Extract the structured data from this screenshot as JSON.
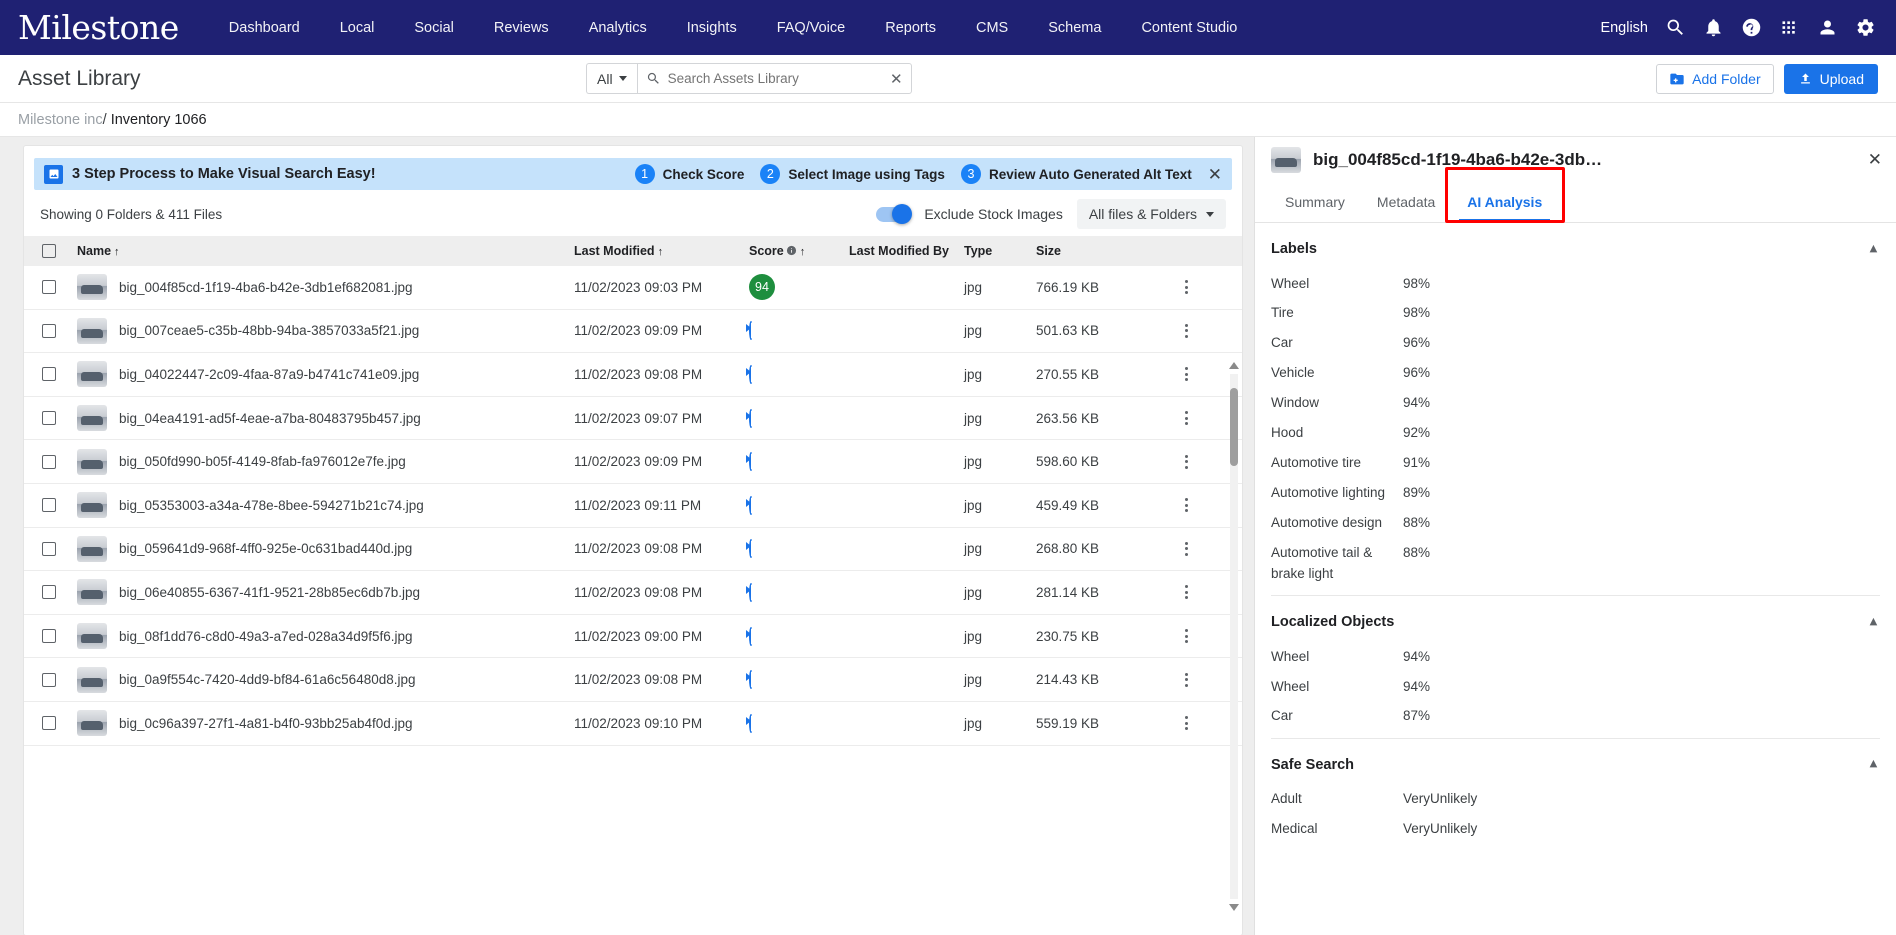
{
  "topnav": {
    "brand": "Milestone",
    "links": [
      "Dashboard",
      "Local",
      "Social",
      "Reviews",
      "Analytics",
      "Insights",
      "FAQ/Voice",
      "Reports",
      "CMS",
      "Schema",
      "Content Studio"
    ],
    "language": "English",
    "icons": [
      "search-icon",
      "bell-icon",
      "help-icon",
      "apps-grid-icon",
      "account-icon",
      "settings-gear-icon"
    ],
    "bg_color": "#1f2173"
  },
  "page_header": {
    "title": "Asset Library",
    "scope_filter": "All",
    "search_placeholder": "Search Assets Library",
    "search_value": "",
    "add_folder_label": "Add Folder",
    "upload_label": "Upload",
    "accent_color": "#1a73e8"
  },
  "breadcrumb": {
    "root": "Milestone inc",
    "separator": "/",
    "current": "Inventory 1066"
  },
  "banner": {
    "title": "3 Step Process to Make Visual Search Easy!",
    "steps": [
      {
        "num": "1",
        "label": "Check Score"
      },
      {
        "num": "2",
        "label": "Select Image using Tags"
      },
      {
        "num": "3",
        "label": "Review Auto Generated Alt Text"
      }
    ],
    "close": "✕",
    "bg_color": "#c5e2fb"
  },
  "toolbar": {
    "showing": "Showing 0 Folders & 411 Files",
    "exclude_stock_label": "Exclude Stock Images",
    "exclude_stock_on": true,
    "file_filter": "All files & Folders"
  },
  "table": {
    "columns": [
      {
        "key": "name",
        "label": "Name",
        "sorted": true,
        "arrow": "↑"
      },
      {
        "key": "modified",
        "label": "Last Modified",
        "sorted": true,
        "arrow": "↑"
      },
      {
        "key": "score",
        "label": "Score",
        "sorted": true,
        "arrow": "↑",
        "info": true
      },
      {
        "key": "modified_by",
        "label": "Last Modified By"
      },
      {
        "key": "type",
        "label": "Type"
      },
      {
        "key": "size",
        "label": "Size"
      }
    ],
    "rows": [
      {
        "name": "big_004f85cd-1f19-4ba6-b42e-3db1ef682081.jpg",
        "modified": "11/02/2023 09:03 PM",
        "score": "94",
        "score_state": "done",
        "modified_by": "",
        "type": "jpg",
        "size": "766.19 KB"
      },
      {
        "name": "big_007ceae5-c35b-48bb-94ba-3857033a5f21.jpg",
        "modified": "11/02/2023 09:09 PM",
        "score": "",
        "score_state": "loading",
        "modified_by": "",
        "type": "jpg",
        "size": "501.63 KB"
      },
      {
        "name": "big_04022447-2c09-4faa-87a9-b4741c741e09.jpg",
        "modified": "11/02/2023 09:08 PM",
        "score": "",
        "score_state": "loading",
        "modified_by": "",
        "type": "jpg",
        "size": "270.55 KB"
      },
      {
        "name": "big_04ea4191-ad5f-4eae-a7ba-80483795b457.jpg",
        "modified": "11/02/2023 09:07 PM",
        "score": "",
        "score_state": "loading",
        "modified_by": "",
        "type": "jpg",
        "size": "263.56 KB"
      },
      {
        "name": "big_050fd990-b05f-4149-8fab-fa976012e7fe.jpg",
        "modified": "11/02/2023 09:09 PM",
        "score": "",
        "score_state": "loading",
        "modified_by": "",
        "type": "jpg",
        "size": "598.60 KB"
      },
      {
        "name": "big_05353003-a34a-478e-8bee-594271b21c74.jpg",
        "modified": "11/02/2023 09:11 PM",
        "score": "",
        "score_state": "loading",
        "modified_by": "",
        "type": "jpg",
        "size": "459.49 KB"
      },
      {
        "name": "big_059641d9-968f-4ff0-925e-0c631bad440d.jpg",
        "modified": "11/02/2023 09:08 PM",
        "score": "",
        "score_state": "loading",
        "modified_by": "",
        "type": "jpg",
        "size": "268.80 KB"
      },
      {
        "name": "big_06e40855-6367-41f1-9521-28b85ec6db7b.jpg",
        "modified": "11/02/2023 09:08 PM",
        "score": "",
        "score_state": "loading",
        "modified_by": "",
        "type": "jpg",
        "size": "281.14 KB"
      },
      {
        "name": "big_08f1dd76-c8d0-49a3-a7ed-028a34d9f5f6.jpg",
        "modified": "11/02/2023 09:00 PM",
        "score": "",
        "score_state": "loading",
        "modified_by": "",
        "type": "jpg",
        "size": "230.75 KB"
      },
      {
        "name": "big_0a9f554c-7420-4dd9-bf84-61a6c56480d8.jpg",
        "modified": "11/02/2023 09:08 PM",
        "score": "",
        "score_state": "loading",
        "modified_by": "",
        "type": "jpg",
        "size": "214.43 KB"
      },
      {
        "name": "big_0c96a397-27f1-4a81-b4f0-93bb25ab4f0d.jpg",
        "modified": "11/02/2023 09:10 PM",
        "score": "",
        "score_state": "loading",
        "modified_by": "",
        "type": "jpg",
        "size": "559.19 KB"
      }
    ]
  },
  "right_panel": {
    "asset_title": "big_004f85cd-1f19-4ba6-b42e-3db…",
    "close": "✕",
    "tabs": [
      {
        "label": "Summary",
        "active": false
      },
      {
        "label": "Metadata",
        "active": false
      },
      {
        "label": "AI Analysis",
        "active": true
      }
    ],
    "highlight_color": "#ff0000",
    "sections": [
      {
        "title": "Labels",
        "collapse_icon": "chevron-up-icon",
        "items": [
          {
            "key": "Wheel",
            "value": "98%"
          },
          {
            "key": "Tire",
            "value": "98%"
          },
          {
            "key": "Car",
            "value": "96%"
          },
          {
            "key": "Vehicle",
            "value": "96%"
          },
          {
            "key": "Window",
            "value": "94%"
          },
          {
            "key": "Hood",
            "value": "92%"
          },
          {
            "key": "Automotive tire",
            "value": "91%"
          },
          {
            "key": "Automotive lighting",
            "value": "89%"
          },
          {
            "key": "Automotive design",
            "value": "88%"
          },
          {
            "key": "Automotive tail & brake light",
            "value": "88%"
          }
        ]
      },
      {
        "title": "Localized Objects",
        "collapse_icon": "chevron-up-icon",
        "items": [
          {
            "key": "Wheel",
            "value": "94%"
          },
          {
            "key": "Wheel",
            "value": "94%"
          },
          {
            "key": "Car",
            "value": "87%"
          }
        ]
      },
      {
        "title": "Safe Search",
        "collapse_icon": "chevron-up-icon",
        "items": [
          {
            "key": "Adult",
            "value": "VeryUnlikely"
          },
          {
            "key": "Medical",
            "value": "VeryUnlikely"
          }
        ]
      }
    ]
  }
}
